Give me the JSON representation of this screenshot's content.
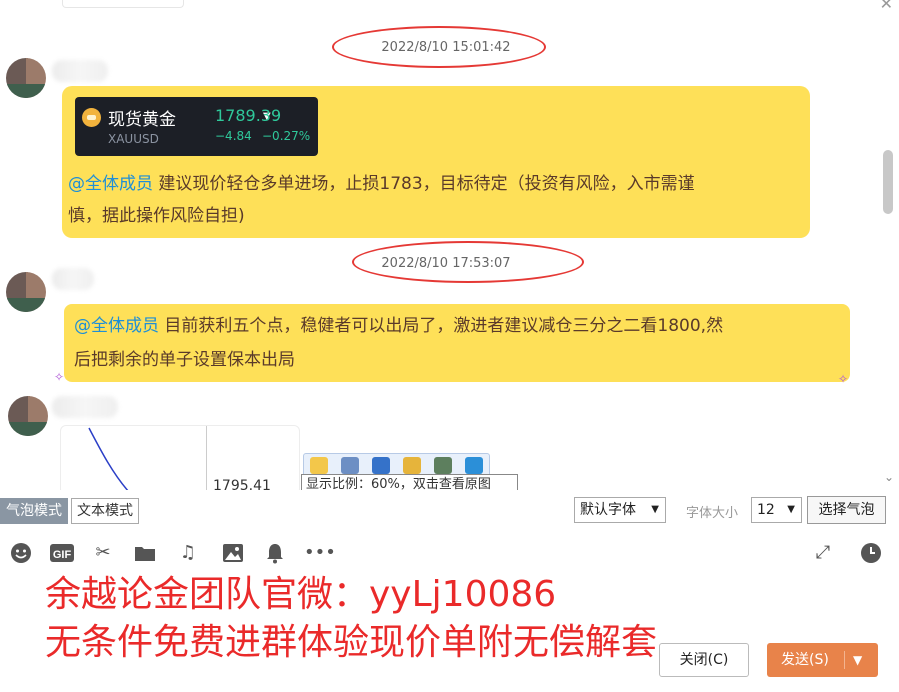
{
  "chat": {
    "messages": [
      {
        "timestamp": "2022/8/10 15:01:42",
        "ticker": {
          "name": "现货黄金",
          "symbol": "XAUUSD",
          "price": "1789.39",
          "change": "−4.84",
          "change_pct": "−0.27%"
        },
        "mention": "@全体成员",
        "text_line1": "建议现价轻仓多单进场，止损1783，目标待定（投资有风险，入市需谨",
        "text_line2": "慎，据此操作风险自担)"
      },
      {
        "timestamp": "2022/8/10 17:53:07",
        "mention": "@全体成员",
        "text_line1": "目前获利五个点，稳健者可以出局了，激进者建议减仓三分之二看1800,然",
        "text_line2": "后把剩余的单子设置保本出局"
      }
    ],
    "image_partial_text": "1795.41",
    "image_zoom_tip": "显示比例：60%，双击查看原图"
  },
  "input_toolbar": {
    "bubble_mode": "气泡模式",
    "text_mode": "文本模式",
    "font_select": "默认字体",
    "font_size_label": "字体大小",
    "font_size_value": "12",
    "choose_bubble": "选择气泡"
  },
  "tool_icons": [
    "emoji-icon",
    "gif-icon",
    "scissors-icon",
    "folder-icon",
    "music-icon",
    "image-icon",
    "bell-icon",
    "more-icon",
    "expand-icon",
    "clock-icon"
  ],
  "gif_label": "GIF",
  "promo": {
    "line1": "余越论金团队官微：yyLj10086",
    "line2": "无条件免费进群体验现价单附无偿解套"
  },
  "buttons": {
    "close": "关闭(C)",
    "send": "发送(S)"
  },
  "colors": {
    "bubble": "#fee058",
    "mention": "#1f8fd6",
    "ticker_up": "#2fc99b",
    "annotation_red": "#e53935",
    "promo_red": "#ea2a2a",
    "send_button": "#e8834a"
  }
}
